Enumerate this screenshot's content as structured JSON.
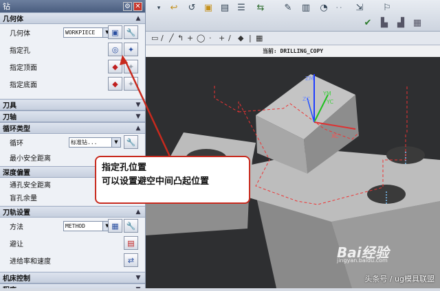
{
  "dialog": {
    "title": "钻",
    "sections": {
      "geometry": "几何体",
      "tool": "刀具",
      "axis": "刀轴",
      "cycle_type": "循环类型",
      "depth_offset": "深度偏置",
      "toolpath_settings": "刀轨设置",
      "machine_control": "机床控制",
      "program": "程序"
    },
    "geometry": {
      "label": "几何体",
      "value": "WORKPIECE",
      "specify_holes": "指定孔",
      "specify_top": "指定顶面",
      "specify_bottom": "指定底面"
    },
    "cycle": {
      "label": "循环",
      "value": "标准钻...",
      "min_clearance": "最小安全距离"
    },
    "depth": {
      "through_clearance": "通孔安全距离",
      "blind_stock": "盲孔余量"
    },
    "toolpath": {
      "method_label": "方法",
      "method_value": "METHOD",
      "avoidance": "避让",
      "feeds_speeds": "进给率和速度"
    }
  },
  "viewport": {
    "header": "当前: DRILLING_COPY",
    "axes": [
      "ZM",
      "YM",
      "ZC",
      "YC",
      "XC"
    ]
  },
  "callout": {
    "line1": "指定孔位置",
    "line2": "可以设置避空中间凸起位置"
  },
  "watermark": {
    "text": "头条号 / ug模具联盟",
    "baidu": "Bai经验",
    "url": "jingyan.baidu.com"
  },
  "colors": {
    "accent_red": "#c82a1e",
    "panel_bg": "#eef1f6",
    "viewport_bg": "#2e2f31",
    "part_top": "#b9b9b9",
    "part_side": "#8f8f8f"
  }
}
